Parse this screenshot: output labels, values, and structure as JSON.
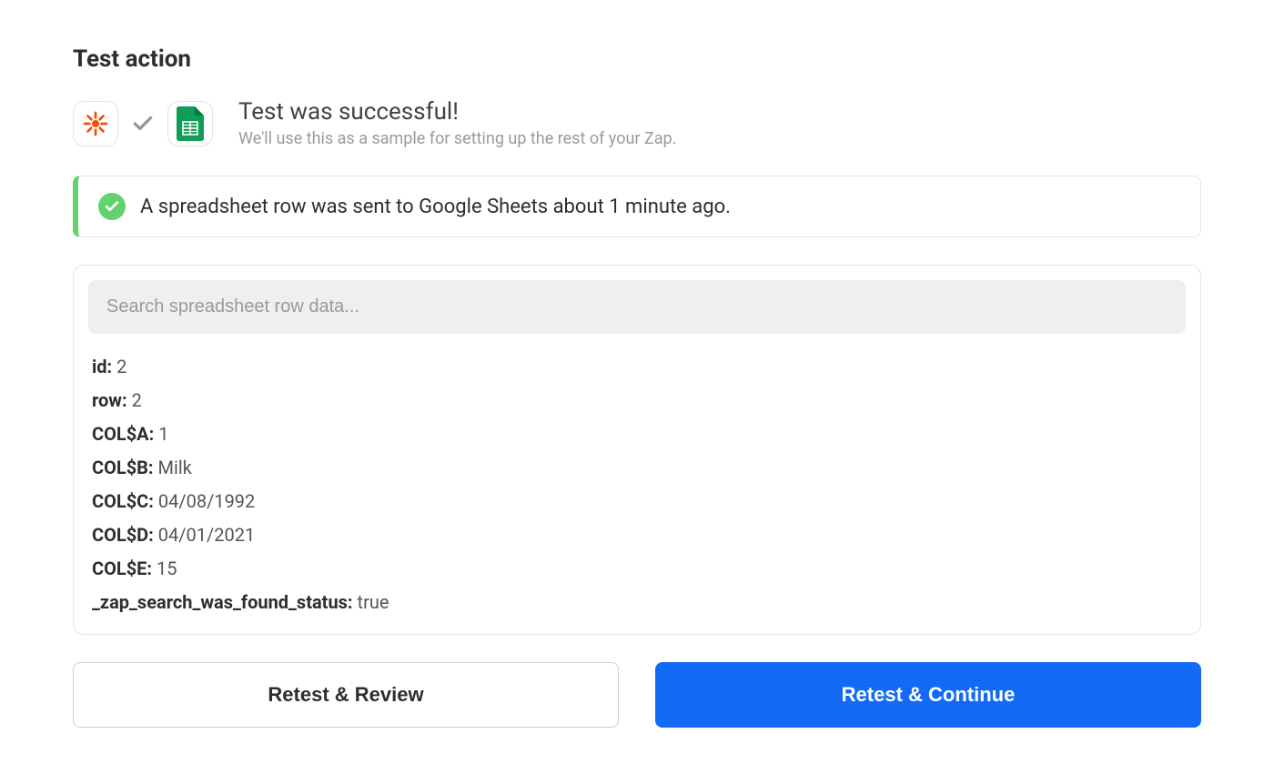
{
  "page": {
    "title": "Test action"
  },
  "header": {
    "title": "Test was successful!",
    "subtitle": "We'll use this as a sample for setting up the rest of your Zap."
  },
  "status": {
    "message": "A spreadsheet row was sent to Google Sheets about 1 minute ago."
  },
  "search": {
    "placeholder": "Search spreadsheet row data..."
  },
  "data_rows": [
    {
      "key": "id:",
      "value": "2"
    },
    {
      "key": "row:",
      "value": "2"
    },
    {
      "key": "COL$A:",
      "value": "1"
    },
    {
      "key": "COL$B:",
      "value": "Milk"
    },
    {
      "key": "COL$C:",
      "value": "04/08/1992"
    },
    {
      "key": "COL$D:",
      "value": "04/01/2021"
    },
    {
      "key": "COL$E:",
      "value": "15"
    },
    {
      "key": "_zap_search_was_found_status:",
      "value": "true"
    }
  ],
  "buttons": {
    "retest_review": "Retest & Review",
    "retest_continue": "Retest & Continue"
  }
}
